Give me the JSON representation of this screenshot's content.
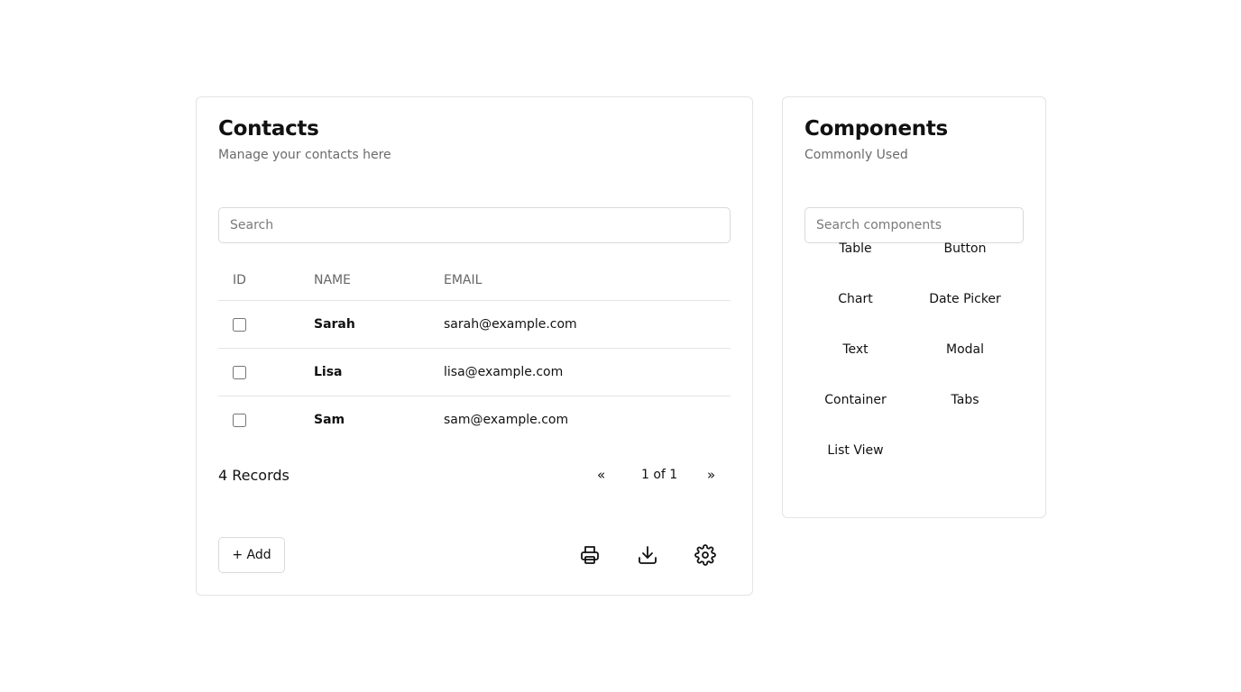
{
  "contacts": {
    "title": "Contacts",
    "subtitle": "Manage your contacts here",
    "search_placeholder": "Search",
    "columns": {
      "id": "ID",
      "name": "NAME",
      "email": "EMAIL"
    },
    "rows": [
      {
        "name": "Sarah",
        "email": "sarah@example.com",
        "checked": false
      },
      {
        "name": "Lisa",
        "email": "lisa@example.com",
        "checked": false
      },
      {
        "name": "Sam",
        "email": "sam@example.com",
        "checked": false
      }
    ],
    "records_label": "4 Records",
    "pagination": {
      "prev": "«",
      "status": "1 of 1",
      "next": "»"
    },
    "add_label": "+ Add",
    "icons": [
      "printer-icon",
      "download-icon",
      "gear-icon"
    ]
  },
  "components": {
    "title": "Components",
    "subtitle": "Commonly Used",
    "search_placeholder": "Search components",
    "items": [
      "Table",
      "Button",
      "Chart",
      "Date Picker",
      "Text",
      "Modal",
      "Container",
      "Tabs",
      "List View"
    ]
  }
}
